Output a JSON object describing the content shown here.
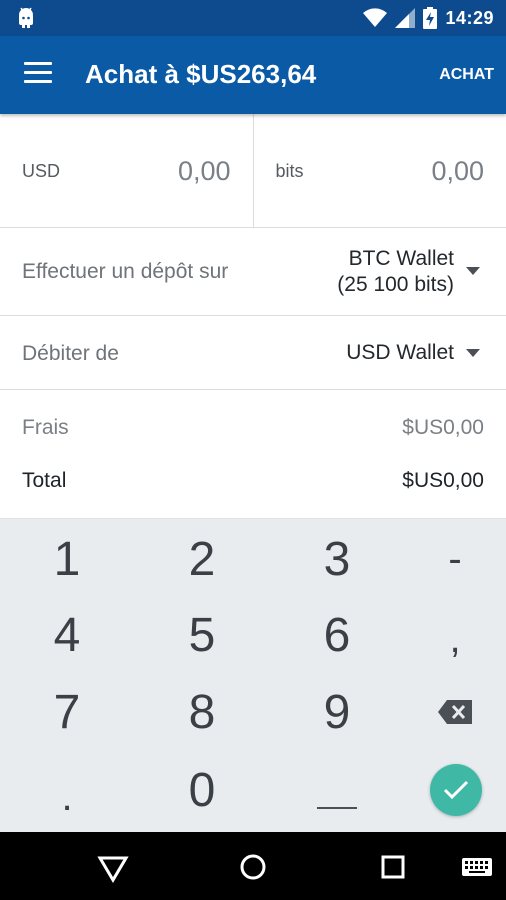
{
  "status_bar": {
    "time": "14:29",
    "icons": [
      "android-icon",
      "wifi-icon",
      "signal-icon",
      "battery-charging-icon"
    ]
  },
  "app_bar": {
    "title": "Achat à $US263,64",
    "action_label": "ACHAT"
  },
  "amount": {
    "left": {
      "currency": "USD",
      "value": "0,00"
    },
    "right": {
      "currency": "bits",
      "value": "0,00"
    }
  },
  "deposit": {
    "label": "Effectuer un dépôt sur",
    "wallet_name": "BTC Wallet",
    "wallet_balance": "(25 100 bits)"
  },
  "debit": {
    "label": "Débiter de",
    "wallet_name": "USD Wallet"
  },
  "fees": {
    "fee_label": "Frais",
    "fee_value": "$US0,00",
    "total_label": "Total",
    "total_value": "$US0,00"
  },
  "keypad": {
    "k1": "1",
    "k2": "2",
    "k3": "3",
    "k_minus": "-",
    "k4": "4",
    "k5": "5",
    "k6": "6",
    "k_comma": ",",
    "k7": "7",
    "k8": "8",
    "k9": "9",
    "k_dot": ".",
    "k0": "0",
    "k_space": "___"
  },
  "colors": {
    "app_bar": "#0a5aa6",
    "status_bar": "#0d4b8e",
    "confirm_button": "#3fb8a6",
    "keypad_bg": "#e8ecef"
  }
}
